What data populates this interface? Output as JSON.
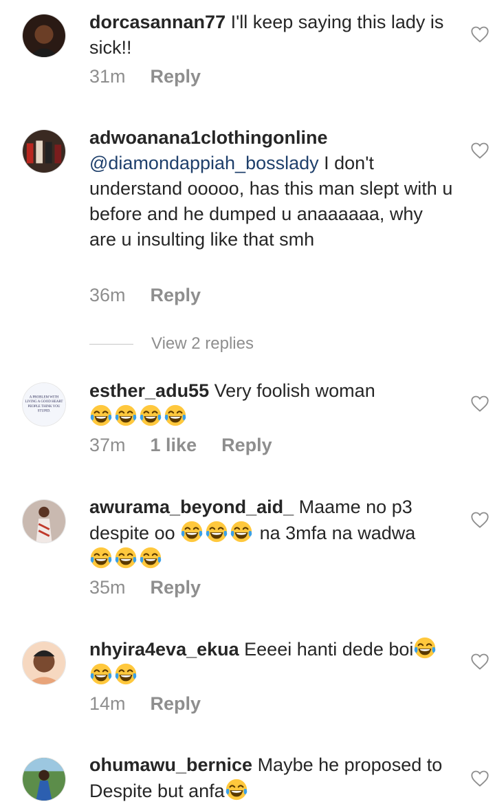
{
  "comments": [
    {
      "username": "dorcasannan77",
      "text": " I'll keep saying this lady is sick!!",
      "time": "31m",
      "reply_label": "Reply"
    },
    {
      "username": "adwoanana1clothingonline",
      "mention": "@diamondappiah_bosslady",
      "text": " I don't understand ooooo, has this man slept with u before and he dumped u anaaaaaa, why are u insulting like that smh",
      "time": "36m",
      "reply_label": "Reply"
    },
    {
      "username": "esther_adu55",
      "text": " Very foolish woman",
      "time": "37m",
      "likes": "1 like",
      "reply_label": "Reply",
      "avatar_text": "A PROBLEM WITH LIVING A GOOD HEART PEOPLE THINK YOU STUPID."
    },
    {
      "username": "awurama_beyond_aid_",
      "text_a": " Maame no p3 despite oo ",
      "text_b": " na 3mfa na wadwa",
      "time": "35m",
      "reply_label": "Reply"
    },
    {
      "username": "nhyira4eva_ekua",
      "text": " Eeeei hanti dede boi",
      "time": "14m",
      "reply_label": "Reply"
    },
    {
      "username": "ohumawu_bernice",
      "text": " Maybe he proposed to Despite but anfa"
    }
  ],
  "view_replies": "View 2 replies",
  "icons": {
    "like": "heart-outline-icon",
    "emoji": "face-with-tears-of-joy-emoji"
  },
  "colors": {
    "text": "#262626",
    "secondary": "#8e8e8e",
    "mention": "#1e3f6b",
    "emoji_face": "#ffc83d"
  }
}
